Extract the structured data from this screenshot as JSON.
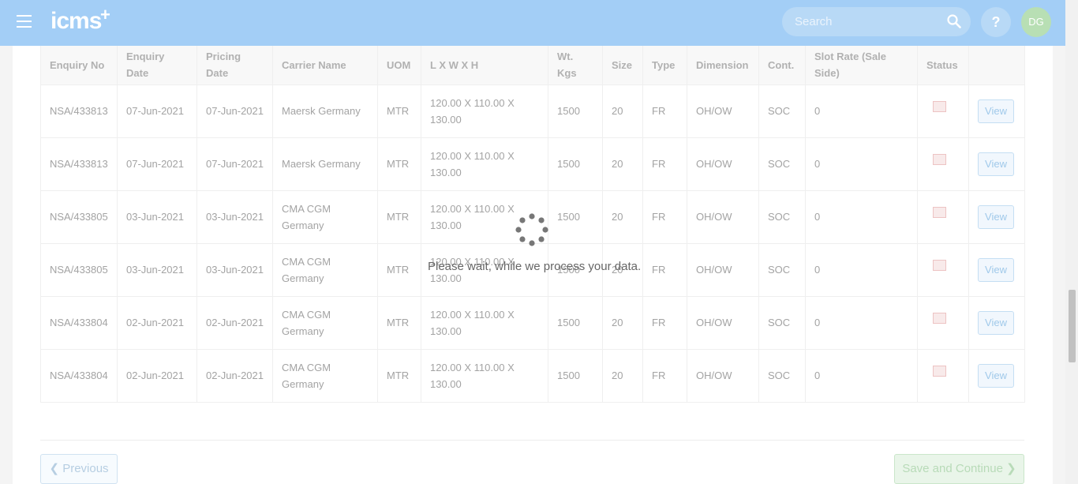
{
  "navbar": {
    "logo_text": "icms",
    "logo_plus": "+",
    "search_placeholder": "Search",
    "help_label": "?",
    "avatar_initials": "DG"
  },
  "table": {
    "headers": [
      "Enquiry No",
      "Enquiry Date",
      "Pricing Date",
      "Carrier Name",
      "UOM",
      "L X W X H",
      "Wt. Kgs",
      "Size",
      "Type",
      "Dimension",
      "Cont.",
      "Slot Rate (Sale Side)",
      "Status",
      ""
    ],
    "rows": [
      {
        "enquiry_no": "NSA/433813",
        "enquiry_date": "07-Jun-2021",
        "pricing_date": "07-Jun-2021",
        "carrier": "Maersk Germany",
        "uom": "MTR",
        "dims": "120.00 X 110.00 X 130.00",
        "wt": "1500",
        "size": "20",
        "type": "FR",
        "dimension": "OH/OW",
        "cont": "SOC",
        "slot_rate": "0",
        "action": "View"
      },
      {
        "enquiry_no": "NSA/433813",
        "enquiry_date": "07-Jun-2021",
        "pricing_date": "07-Jun-2021",
        "carrier": "Maersk Germany",
        "uom": "MTR",
        "dims": "120.00 X 110.00 X 130.00",
        "wt": "1500",
        "size": "20",
        "type": "FR",
        "dimension": "OH/OW",
        "cont": "SOC",
        "slot_rate": "0",
        "action": "View"
      },
      {
        "enquiry_no": "NSA/433805",
        "enquiry_date": "03-Jun-2021",
        "pricing_date": "03-Jun-2021",
        "carrier": "CMA CGM Germany",
        "uom": "MTR",
        "dims": "120.00 X 110.00 X 130.00",
        "wt": "1500",
        "size": "20",
        "type": "FR",
        "dimension": "OH/OW",
        "cont": "SOC",
        "slot_rate": "0",
        "action": "View"
      },
      {
        "enquiry_no": "NSA/433805",
        "enquiry_date": "03-Jun-2021",
        "pricing_date": "03-Jun-2021",
        "carrier": "CMA CGM Germany",
        "uom": "MTR",
        "dims": "120.00 X 110.00 X 130.00",
        "wt": "1500",
        "size": "20",
        "type": "FR",
        "dimension": "OH/OW",
        "cont": "SOC",
        "slot_rate": "0",
        "action": "View"
      },
      {
        "enquiry_no": "NSA/433804",
        "enquiry_date": "02-Jun-2021",
        "pricing_date": "02-Jun-2021",
        "carrier": "CMA CGM Germany",
        "uom": "MTR",
        "dims": "120.00 X 110.00 X 130.00",
        "wt": "1500",
        "size": "20",
        "type": "FR",
        "dimension": "OH/OW",
        "cont": "SOC",
        "slot_rate": "0",
        "action": "View"
      },
      {
        "enquiry_no": "NSA/433804",
        "enquiry_date": "02-Jun-2021",
        "pricing_date": "02-Jun-2021",
        "carrier": "CMA CGM Germany",
        "uom": "MTR",
        "dims": "120.00 X 110.00 X 130.00",
        "wt": "1500",
        "size": "20",
        "type": "FR",
        "dimension": "OH/OW",
        "cont": "SOC",
        "slot_rate": "0",
        "action": "View"
      }
    ]
  },
  "footer": {
    "previous_label": "Previous",
    "save_label": "Save and Continue"
  },
  "loading": {
    "message": "Please wait, while we process your data."
  },
  "colors": {
    "navbar": "#8fc4f4",
    "avatar": "#a9d8a4",
    "accent": "#8bbde6"
  }
}
